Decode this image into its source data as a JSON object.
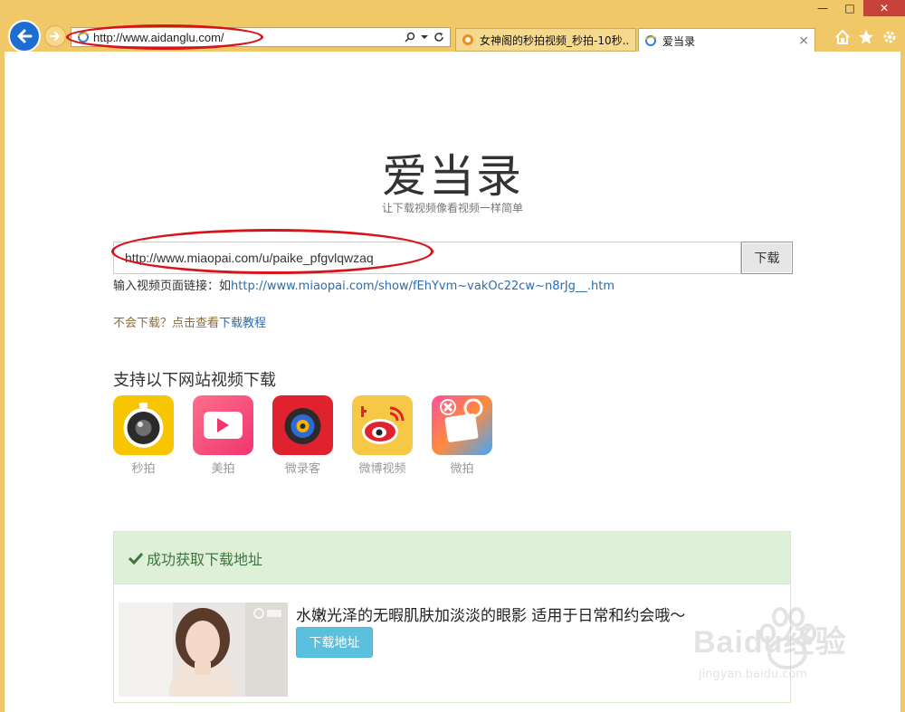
{
  "browser": {
    "address_url": "http://www.aidanglu.com/",
    "tabs": [
      {
        "label": "女神阁的秒拍视频_秒拍-10秒...",
        "active": false
      },
      {
        "label": "爱当录",
        "active": true
      }
    ],
    "tab_close": "×",
    "window_controls": {
      "minimize": "—",
      "maximize": "□",
      "close": "✕"
    }
  },
  "page": {
    "title": "爱当录",
    "subtitle": "让下载视频像看视频一样简单",
    "search": {
      "value": "http://www.miaopai.com/u/paike_pfgvlqwzaq",
      "button_label": "下载"
    },
    "hint": {
      "prefix": "输入视频页面链接：如",
      "example_link": "http://www.miaopai.com/show/fEhYvm~vakOc22cw~n8rJg__.htm"
    },
    "help": {
      "text": "不会下载？点击查看",
      "link": "下载教程"
    },
    "sites_heading": "支持以下网站视频下载",
    "sites": [
      {
        "name": "秒拍",
        "icon": "miaopai-icon"
      },
      {
        "name": "美拍",
        "icon": "meipai-icon"
      },
      {
        "name": "微录客",
        "icon": "weiluke-icon"
      },
      {
        "name": "微博视频",
        "icon": "weibo-icon"
      },
      {
        "name": "微拍",
        "icon": "weipai-icon"
      }
    ],
    "result": {
      "heading": "成功获取下载地址",
      "video_title": "水嫩光泽的无暇肌肤加淡淡的眼影 适用于日常和约会哦～",
      "download_button": "下载地址"
    }
  },
  "watermark": {
    "brand": "Baidu经验",
    "url": "jingyan.baidu.com"
  },
  "colors": {
    "frame": "#f0c868",
    "annotation_red": "#d8141b",
    "success_bg": "#dff0d8",
    "success_text": "#3c763d",
    "link": "#2a6db0",
    "info_button": "#5bc0de"
  }
}
